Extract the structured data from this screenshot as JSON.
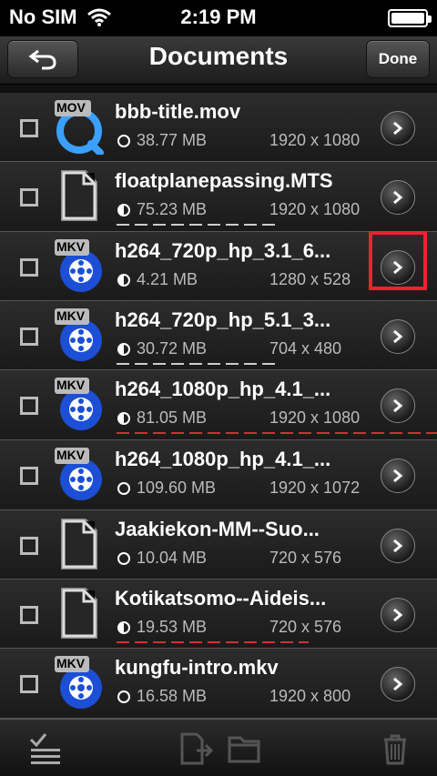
{
  "status": {
    "carrier": "No SIM",
    "time": "2:19 PM"
  },
  "nav": {
    "title": "Documents",
    "done": "Done"
  },
  "files": [
    {
      "name": "bbb-title.mov",
      "size": "38.77 MB",
      "res": "1920 x 1080",
      "type": "mov",
      "badge": "MOV",
      "progress": 0,
      "ring": "empty"
    },
    {
      "name": "floatplanepassing.MTS",
      "size": "75.23 MB",
      "res": "1920 x 1080",
      "type": "doc",
      "badge": "",
      "progress": 0.5,
      "ring": "half"
    },
    {
      "name": "h264_720p_hp_3.1_6...",
      "size": "4.21 MB",
      "res": "1280 x 528",
      "type": "mkv",
      "badge": "MKV",
      "progress": 0,
      "ring": "half"
    },
    {
      "name": "h264_720p_hp_5.1_3...",
      "size": "30.72 MB",
      "res": "704 x 480",
      "type": "mkv",
      "badge": "MKV",
      "progress": 0.5,
      "ring": "half"
    },
    {
      "name": "h264_1080p_hp_4.1_...",
      "size": "81.05 MB",
      "res": "1920 x 1080",
      "type": "mkv",
      "badge": "MKV",
      "progress": 1,
      "ring": "half",
      "red": true
    },
    {
      "name": "h264_1080p_hp_4.1_...",
      "size": "109.60 MB",
      "res": "1920 x 1072",
      "type": "mkv",
      "badge": "MKV",
      "progress": 0,
      "ring": "empty"
    },
    {
      "name": "Jaakiekon-MM--Suo...",
      "size": "10.04 MB",
      "res": "720 x 576",
      "type": "doc",
      "badge": "",
      "progress": 0,
      "ring": "empty"
    },
    {
      "name": "Kotikatsomo--Aideis...",
      "size": "19.53 MB",
      "res": "720 x 576",
      "type": "doc",
      "badge": "",
      "progress": 0.6,
      "ring": "half",
      "red": true
    },
    {
      "name": "kungfu-intro.mkv",
      "size": "16.58 MB",
      "res": "1920 x 800",
      "type": "mkv",
      "badge": "MKV",
      "progress": 0,
      "ring": "empty"
    }
  ],
  "colors": {
    "highlight": "#e23"
  }
}
